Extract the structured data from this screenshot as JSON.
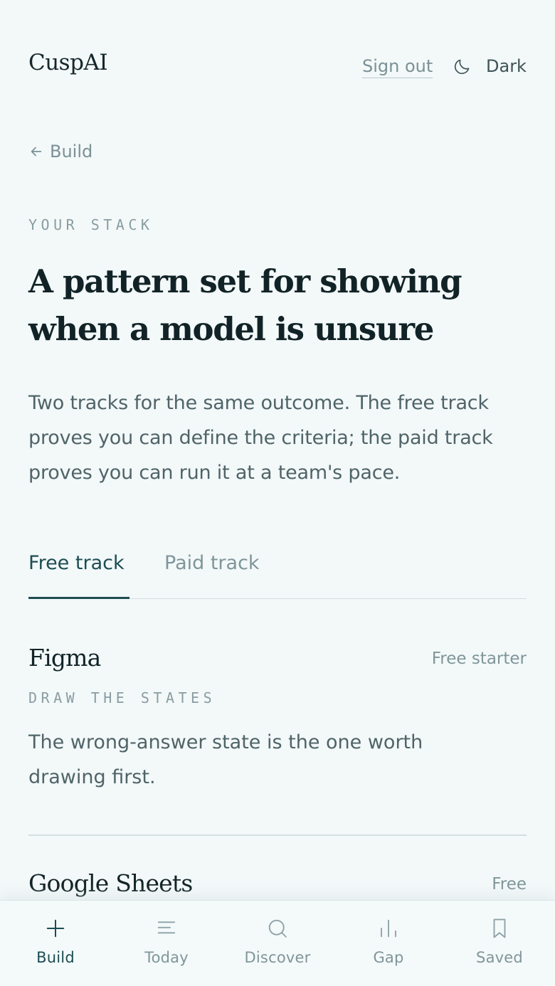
{
  "header": {
    "brand": "CuspAI",
    "sign_out": "Sign out",
    "theme_icon": "moon-icon",
    "theme_label": "Dark"
  },
  "back": {
    "icon": "arrow-left-icon",
    "label": "Build"
  },
  "eyebrow": "YOUR STACK",
  "title": "A pattern set for showing when a model is unsure",
  "description": "Two tracks for the same outcome. The free track proves you can define the criteria; the paid track proves you can run it at a team's pace.",
  "tabs": [
    {
      "label": "Free track",
      "active": true
    },
    {
      "label": "Paid track",
      "active": false
    }
  ],
  "items": [
    {
      "name": "Figma",
      "tag": "Free starter",
      "kicker": "DRAW THE STATES",
      "note": "The wrong-answer state is the one worth drawing first."
    },
    {
      "name": "Google Sheets",
      "tag": "Free"
    }
  ],
  "bottom_nav": [
    {
      "label": "Build",
      "icon": "plus-icon",
      "active": true
    },
    {
      "label": "Today",
      "icon": "lines-icon",
      "active": false
    },
    {
      "label": "Discover",
      "icon": "search-icon",
      "active": false
    },
    {
      "label": "Gap",
      "icon": "bar-chart-icon",
      "active": false
    },
    {
      "label": "Saved",
      "icon": "bookmark-icon",
      "active": false
    }
  ],
  "colors": {
    "background": "#f3f8f9",
    "accent": "#1c4d52",
    "muted": "#7f969a"
  }
}
